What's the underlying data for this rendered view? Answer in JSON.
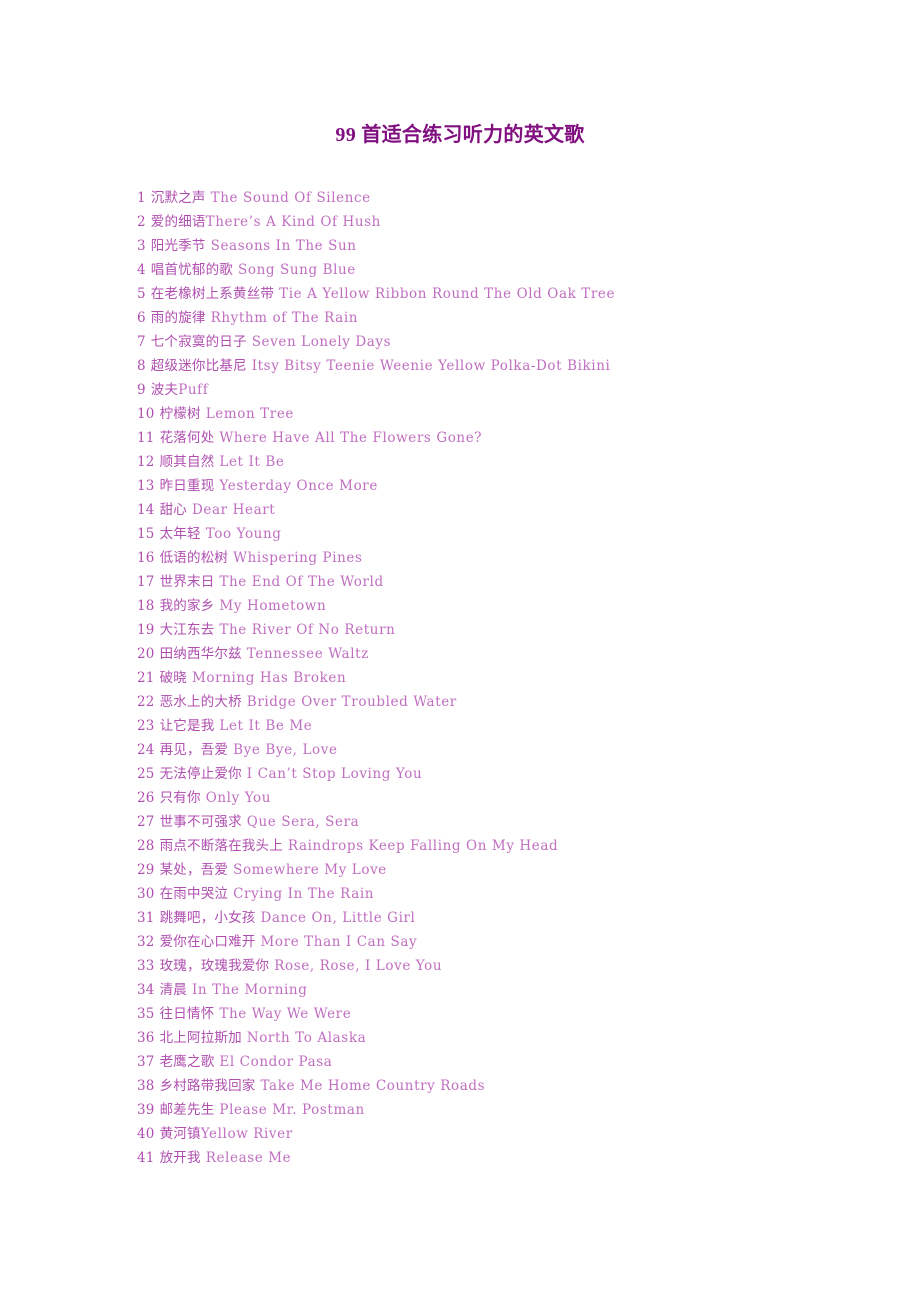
{
  "document": {
    "title": "99 首适合练习听力的英文歌",
    "title_color": "#800f7f",
    "body_color": "#b04fb0",
    "background_color": "#ffffff"
  },
  "songs": [
    {
      "index": "1",
      "chinese": "沉默之声",
      "english": "The Sound Of Silence",
      "gap": true
    },
    {
      "index": "2",
      "chinese": "爱的细语",
      "english": "There’s A Kind Of Hush",
      "gap": false
    },
    {
      "index": "3",
      "chinese": "阳光季节",
      "english": "Seasons In The Sun",
      "gap": true
    },
    {
      "index": "4",
      "chinese": "唱首忧郁的歌",
      "english": "Song Sung Blue",
      "gap": true
    },
    {
      "index": "5",
      "chinese": "在老橡树上系黄丝带",
      "english": "Tie A Yellow Ribbon Round The Old Oak Tree",
      "gap": true
    },
    {
      "index": "6",
      "chinese": "雨的旋律",
      "english": "Rhythm of The Rain",
      "gap": true
    },
    {
      "index": "7",
      "chinese": "七个寂寞的日子",
      "english": "Seven Lonely Days",
      "gap": true
    },
    {
      "index": "8",
      "chinese": "超级迷你比基尼",
      "english": "Itsy Bitsy Teenie Weenie Yellow Polka-Dot Bikini",
      "gap": true
    },
    {
      "index": "9",
      "chinese": "波夫",
      "english": "Puff",
      "gap": false
    },
    {
      "index": "10",
      "chinese": "柠檬树",
      "english": "Lemon Tree",
      "gap": true
    },
    {
      "index": "11",
      "chinese": "花落何处",
      "english": "Where Have All The Flowers Gone?",
      "gap": true
    },
    {
      "index": "12",
      "chinese": "顺其自然",
      "english": "Let It Be",
      "gap": true
    },
    {
      "index": "13",
      "chinese": "昨日重现",
      "english": "Yesterday Once More",
      "gap": true
    },
    {
      "index": "14",
      "chinese": "甜心",
      "english": "Dear Heart",
      "gap": true
    },
    {
      "index": "15",
      "chinese": "太年轻",
      "english": "Too Young",
      "gap": true
    },
    {
      "index": "16",
      "chinese": "低语的松树",
      "english": "Whispering Pines",
      "gap": true
    },
    {
      "index": "17",
      "chinese": "世界末日",
      "english": "The End Of The World",
      "gap": true
    },
    {
      "index": "18",
      "chinese": "我的家乡",
      "english": "My Hometown",
      "gap": true
    },
    {
      "index": "19",
      "chinese": "大江东去",
      "english": "The River Of No Return",
      "gap": true
    },
    {
      "index": "20",
      "chinese": "田纳西华尔兹",
      "english": "Tennessee Waltz",
      "gap": true
    },
    {
      "index": "21",
      "chinese": "破晓",
      "english": "Morning Has Broken",
      "gap": true
    },
    {
      "index": "22",
      "chinese": "恶水上的大桥",
      "english": "Bridge Over Troubled Water",
      "gap": true
    },
    {
      "index": "23",
      "chinese": "让它是我",
      "english": "Let It Be Me",
      "gap": true
    },
    {
      "index": "24",
      "chinese": "再见，吾爱",
      "english": "Bye Bye, Love",
      "gap": true
    },
    {
      "index": "25",
      "chinese": "无法停止爱你",
      "english": "I Can’t Stop Loving You",
      "gap": true
    },
    {
      "index": "26",
      "chinese": "只有你",
      "english": "Only You",
      "gap": true
    },
    {
      "index": "27",
      "chinese": "世事不可强求",
      "english": "Que Sera, Sera",
      "gap": true
    },
    {
      "index": "28",
      "chinese": "雨点不断落在我头上",
      "english": "Raindrops Keep Falling On My Head",
      "gap": true
    },
    {
      "index": "29",
      "chinese": "某处，吾爱",
      "english": "Somewhere My Love",
      "gap": true
    },
    {
      "index": "30",
      "chinese": "在雨中哭泣",
      "english": "Crying In The Rain",
      "gap": true
    },
    {
      "index": "31",
      "chinese": "跳舞吧，小女孩",
      "english": "Dance On, Little Girl",
      "gap": true
    },
    {
      "index": "32",
      "chinese": "爱你在心口难开",
      "english": "More Than I Can Say",
      "gap": true
    },
    {
      "index": "33",
      "chinese": "玫瑰，玫瑰我爱你",
      "english": "Rose, Rose, I Love You",
      "gap": true
    },
    {
      "index": "34",
      "chinese": "清晨",
      "english": "In The Morning",
      "gap": true
    },
    {
      "index": "35",
      "chinese": "往日情怀",
      "english": "The Way We Were",
      "gap": true
    },
    {
      "index": "36",
      "chinese": "北上阿拉斯加",
      "english": "North To Alaska",
      "gap": true
    },
    {
      "index": "37",
      "chinese": "老鹰之歌",
      "english": "El Condor Pasa",
      "gap": true
    },
    {
      "index": "38",
      "chinese": "乡村路带我回家",
      "english": "Take Me Home Country Roads",
      "gap": true
    },
    {
      "index": "39",
      "chinese": "邮差先生",
      "english": "Please Mr. Postman",
      "gap": true
    },
    {
      "index": "40",
      "chinese": "黄河镇",
      "english": "Yellow River",
      "gap": false
    },
    {
      "index": "41",
      "chinese": "放开我",
      "english": "Release Me",
      "gap": true
    }
  ]
}
